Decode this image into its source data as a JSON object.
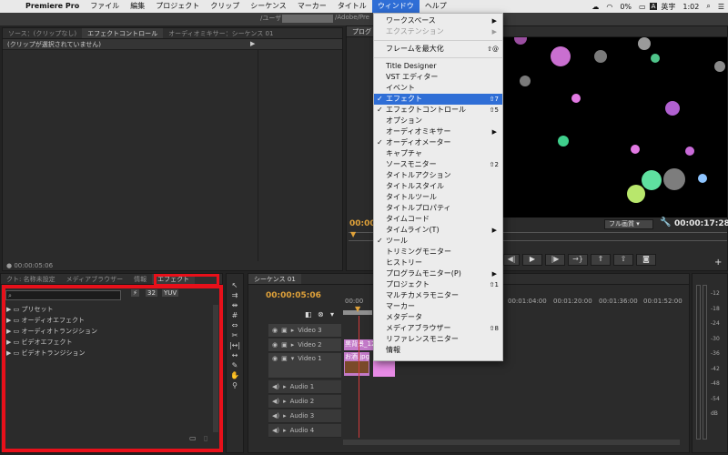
{
  "menubar": {
    "apple": "",
    "app": "Premiere Pro",
    "items": [
      "ファイル",
      "編集",
      "プロジェクト",
      "クリップ",
      "シーケンス",
      "マーカー",
      "タイトル",
      "ウィンドウ",
      "ヘルプ"
    ],
    "status": {
      "battery": "0%",
      "input": "英字",
      "time": "1:02"
    }
  },
  "path_fragment_left": "/ユーザ",
  "path_fragment_right": "/Adobe/Pre",
  "source_panel": {
    "tabs": [
      "ソース：(クリップなし)",
      "エフェクトコントロール",
      "オーディオミキサー：シーケンス 01"
    ],
    "no_clip": "(クリップが選択されていません)",
    "timecode": "00:00:05:06"
  },
  "program_panel": {
    "tab": "プログ",
    "timecode_left": "00:00",
    "timecode_right": "00:00:17:28",
    "quality": "フル画質"
  },
  "effects_panel": {
    "tabs": [
      "クト: 名称未設定",
      "メディアブラウザー",
      "情報",
      "エフェクト"
    ],
    "tree": [
      "プリセット",
      "オーディオエフェクト",
      "オーディオトランジション",
      "ビデオエフェクト",
      "ビデオトランジション"
    ]
  },
  "timeline": {
    "tab": "シーケンス 01",
    "timecode": "00:00:05:06",
    "ruler": [
      "00:00",
      "00:01:04:00",
      "00:01:20:00",
      "00:01:36:00",
      "00:01:52:00"
    ],
    "video_tracks": [
      "Video 3",
      "Video 2",
      "Video 1"
    ],
    "audio_tracks": [
      "Audio 1",
      "Audio 2",
      "Audio 3",
      "Audio 4"
    ],
    "clips": [
      "黒背景_12",
      "お酒.jpg"
    ]
  },
  "meter": {
    "labels": [
      "-12",
      "-18",
      "-24",
      "-30",
      "-36",
      "-42",
      "-48",
      "-54",
      "dB"
    ]
  },
  "window_menu": {
    "items": [
      {
        "label": "ワークスペース",
        "arrow": "▶"
      },
      {
        "label": "エクステンション",
        "arrow": "▶",
        "disabled": true
      },
      {
        "label": "フレームを最大化",
        "sc": "⇧@"
      },
      {
        "label": "Title Designer"
      },
      {
        "label": "VST エディター"
      },
      {
        "label": "イベント"
      },
      {
        "label": "エフェクト",
        "check": "✓",
        "sc": "⇧7",
        "highlight": true
      },
      {
        "label": "エフェクトコントロール",
        "check": "✓",
        "sc": "⇧5"
      },
      {
        "label": "オプション"
      },
      {
        "label": "オーディオミキサー",
        "arrow": "▶"
      },
      {
        "label": "オーディオメーター",
        "check": "✓"
      },
      {
        "label": "キャプチャ"
      },
      {
        "label": "ソースモニター",
        "sc": "⇧2"
      },
      {
        "label": "タイトルアクション"
      },
      {
        "label": "タイトルスタイル"
      },
      {
        "label": "タイトルツール"
      },
      {
        "label": "タイトルプロパティ"
      },
      {
        "label": "タイムコード"
      },
      {
        "label": "タイムライン(T)",
        "arrow": "▶"
      },
      {
        "label": "ツール",
        "check": "✓"
      },
      {
        "label": "トリミングモニター"
      },
      {
        "label": "ヒストリー"
      },
      {
        "label": "プログラムモニター(P)",
        "arrow": "▶"
      },
      {
        "label": "プロジェクト",
        "sc": "⇧1"
      },
      {
        "label": "マルチカメラモニター"
      },
      {
        "label": "マーカー"
      },
      {
        "label": "メタデータ"
      },
      {
        "label": "メディアブラウザー",
        "sc": "⇧8"
      },
      {
        "label": "リファレンスモニター"
      },
      {
        "label": "情報"
      }
    ]
  }
}
